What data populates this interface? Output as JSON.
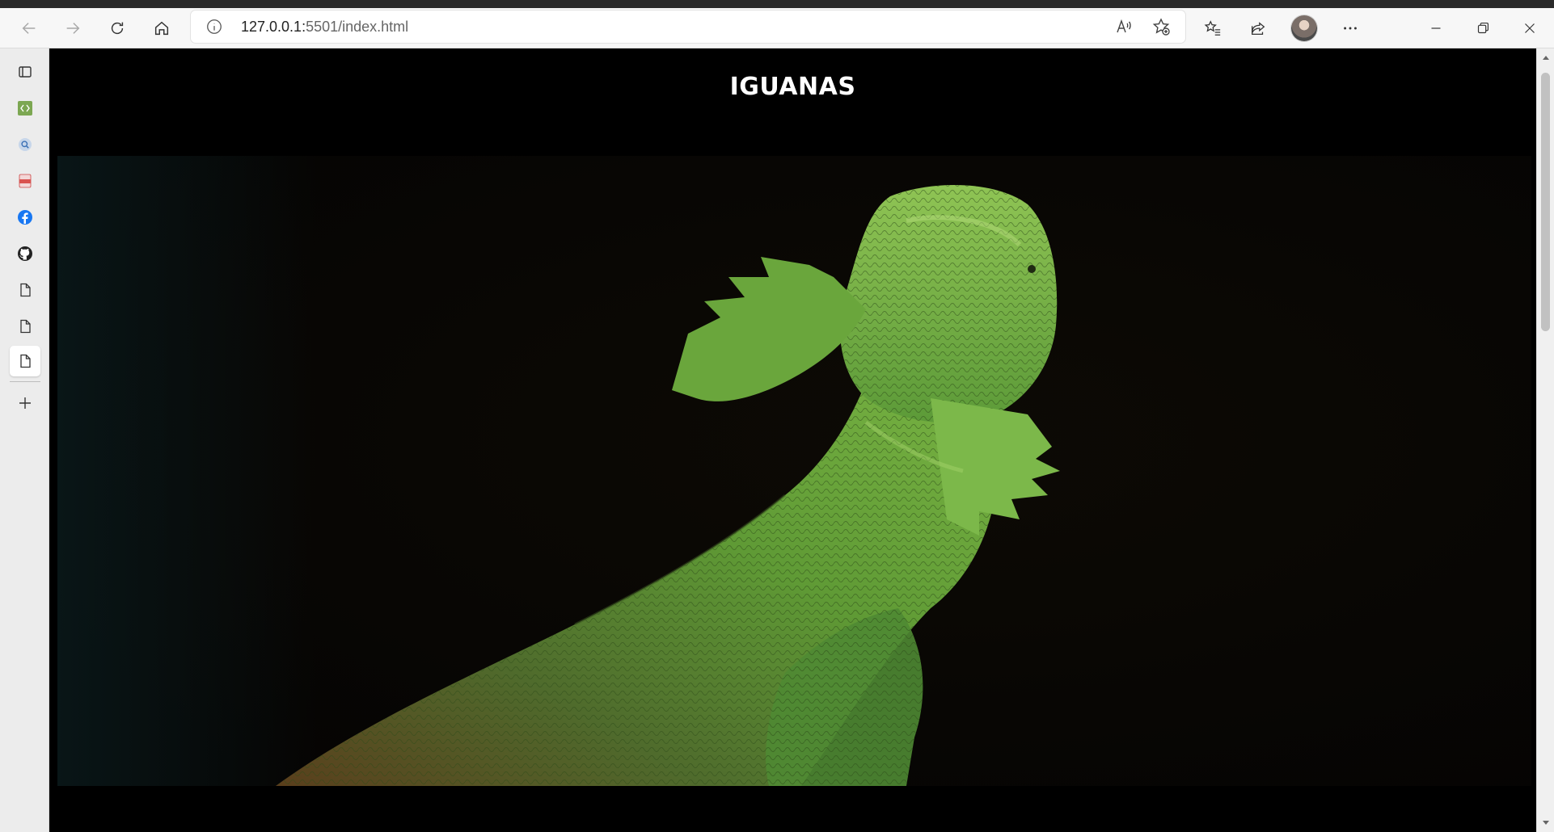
{
  "browser": {
    "url_host": "127.0.0.1:",
    "url_rest": "5501/index.html"
  },
  "sidebar": {
    "items": [
      {
        "icon": "tab-actions-icon"
      },
      {
        "icon": "code-icon"
      },
      {
        "icon": "search-icon"
      },
      {
        "icon": "pdf-icon"
      },
      {
        "icon": "facebook-icon"
      },
      {
        "icon": "github-icon"
      },
      {
        "icon": "document-icon"
      },
      {
        "icon": "document-icon"
      },
      {
        "icon": "document-icon"
      },
      {
        "icon": "add-icon"
      }
    ]
  },
  "page": {
    "title": "IGUANAS",
    "hero_image": "iguana-photo"
  },
  "colors": {
    "page_background": "#000000",
    "title_color": "#ffffff",
    "iguana_green": "#6fae3a"
  }
}
